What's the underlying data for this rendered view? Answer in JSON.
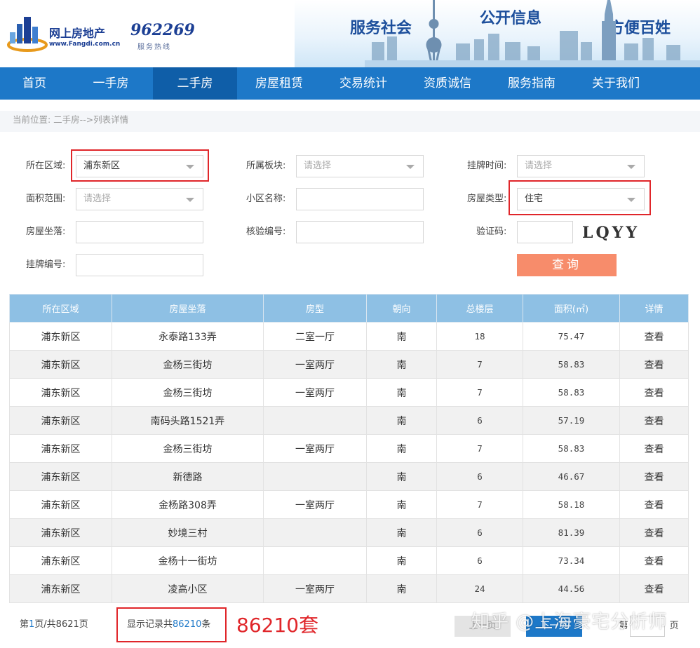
{
  "header": {
    "logo_text": "网上房地产",
    "logo_sub": "www.Fangdi.com.cn",
    "hotline": "962269",
    "hotline_sub": "服务热线",
    "slogans": [
      "服务社会",
      "公开信息",
      "方便百姓"
    ]
  },
  "nav": {
    "items": [
      "首页",
      "一手房",
      "二手房",
      "房屋租赁",
      "交易统计",
      "资质诚信",
      "服务指南",
      "关于我们"
    ],
    "active_index": 2
  },
  "breadcrumb": "当前位置: 二手房-->列表详情",
  "form": {
    "region_label": "所在区域:",
    "region_value": "浦东新区",
    "block_label": "所属板块:",
    "block_placeholder": "请选择",
    "listtime_label": "挂牌时间:",
    "listtime_placeholder": "请选择",
    "area_label": "面积范围:",
    "area_placeholder": "请选择",
    "community_label": "小区名称:",
    "type_label": "房屋类型:",
    "type_value": "住宅",
    "address_label": "房屋坐落:",
    "verify_label": "核验编号:",
    "captcha_label": "验证码:",
    "captcha_text": "LQYY",
    "listing_label": "挂牌编号:",
    "query_button": "查询"
  },
  "table": {
    "headers": [
      "所在区域",
      "房屋坐落",
      "房型",
      "朝向",
      "总楼层",
      "面积(㎡)",
      "详情"
    ],
    "rows": [
      [
        "浦东新区",
        "永泰路133弄",
        "二室一厅",
        "南",
        "18",
        "75.47",
        "查看"
      ],
      [
        "浦东新区",
        "金杨三街坊",
        "一室两厅",
        "南",
        "7",
        "58.83",
        "查看"
      ],
      [
        "浦东新区",
        "金杨三街坊",
        "一室两厅",
        "南",
        "7",
        "58.83",
        "查看"
      ],
      [
        "浦东新区",
        "南码头路1521弄",
        "",
        "南",
        "6",
        "57.19",
        "查看"
      ],
      [
        "浦东新区",
        "金杨三街坊",
        "一室两厅",
        "南",
        "7",
        "58.83",
        "查看"
      ],
      [
        "浦东新区",
        "新德路",
        "",
        "南",
        "6",
        "46.67",
        "查看"
      ],
      [
        "浦东新区",
        "金杨路308弄",
        "一室两厅",
        "南",
        "7",
        "58.18",
        "查看"
      ],
      [
        "浦东新区",
        "妙境三村",
        "",
        "南",
        "6",
        "81.39",
        "查看"
      ],
      [
        "浦东新区",
        "金杨十一街坊",
        "",
        "南",
        "6",
        "73.34",
        "查看"
      ],
      [
        "浦东新区",
        "凌高小区",
        "一室两厅",
        "南",
        "24",
        "44.56",
        "查看"
      ]
    ]
  },
  "footer": {
    "page_prefix": "第",
    "page_current": "1",
    "page_suffix": "页/共8621页",
    "records_prefix": "显示记录共",
    "records_count": "86210",
    "records_suffix": "条",
    "annotation": "86210套",
    "prev_button": "上一页",
    "next_button": "下一页",
    "goto_prefix": "第",
    "goto_suffix": "页"
  },
  "watermark": "知乎 @上海豪宅分析师",
  "colors": {
    "nav": "#1d78c8",
    "nav_active": "#0f5ea8",
    "table_header": "#8ec0e4",
    "query_button": "#f78c6b",
    "highlight_red": "#e0262a",
    "link_blue": "#1d78c8"
  }
}
